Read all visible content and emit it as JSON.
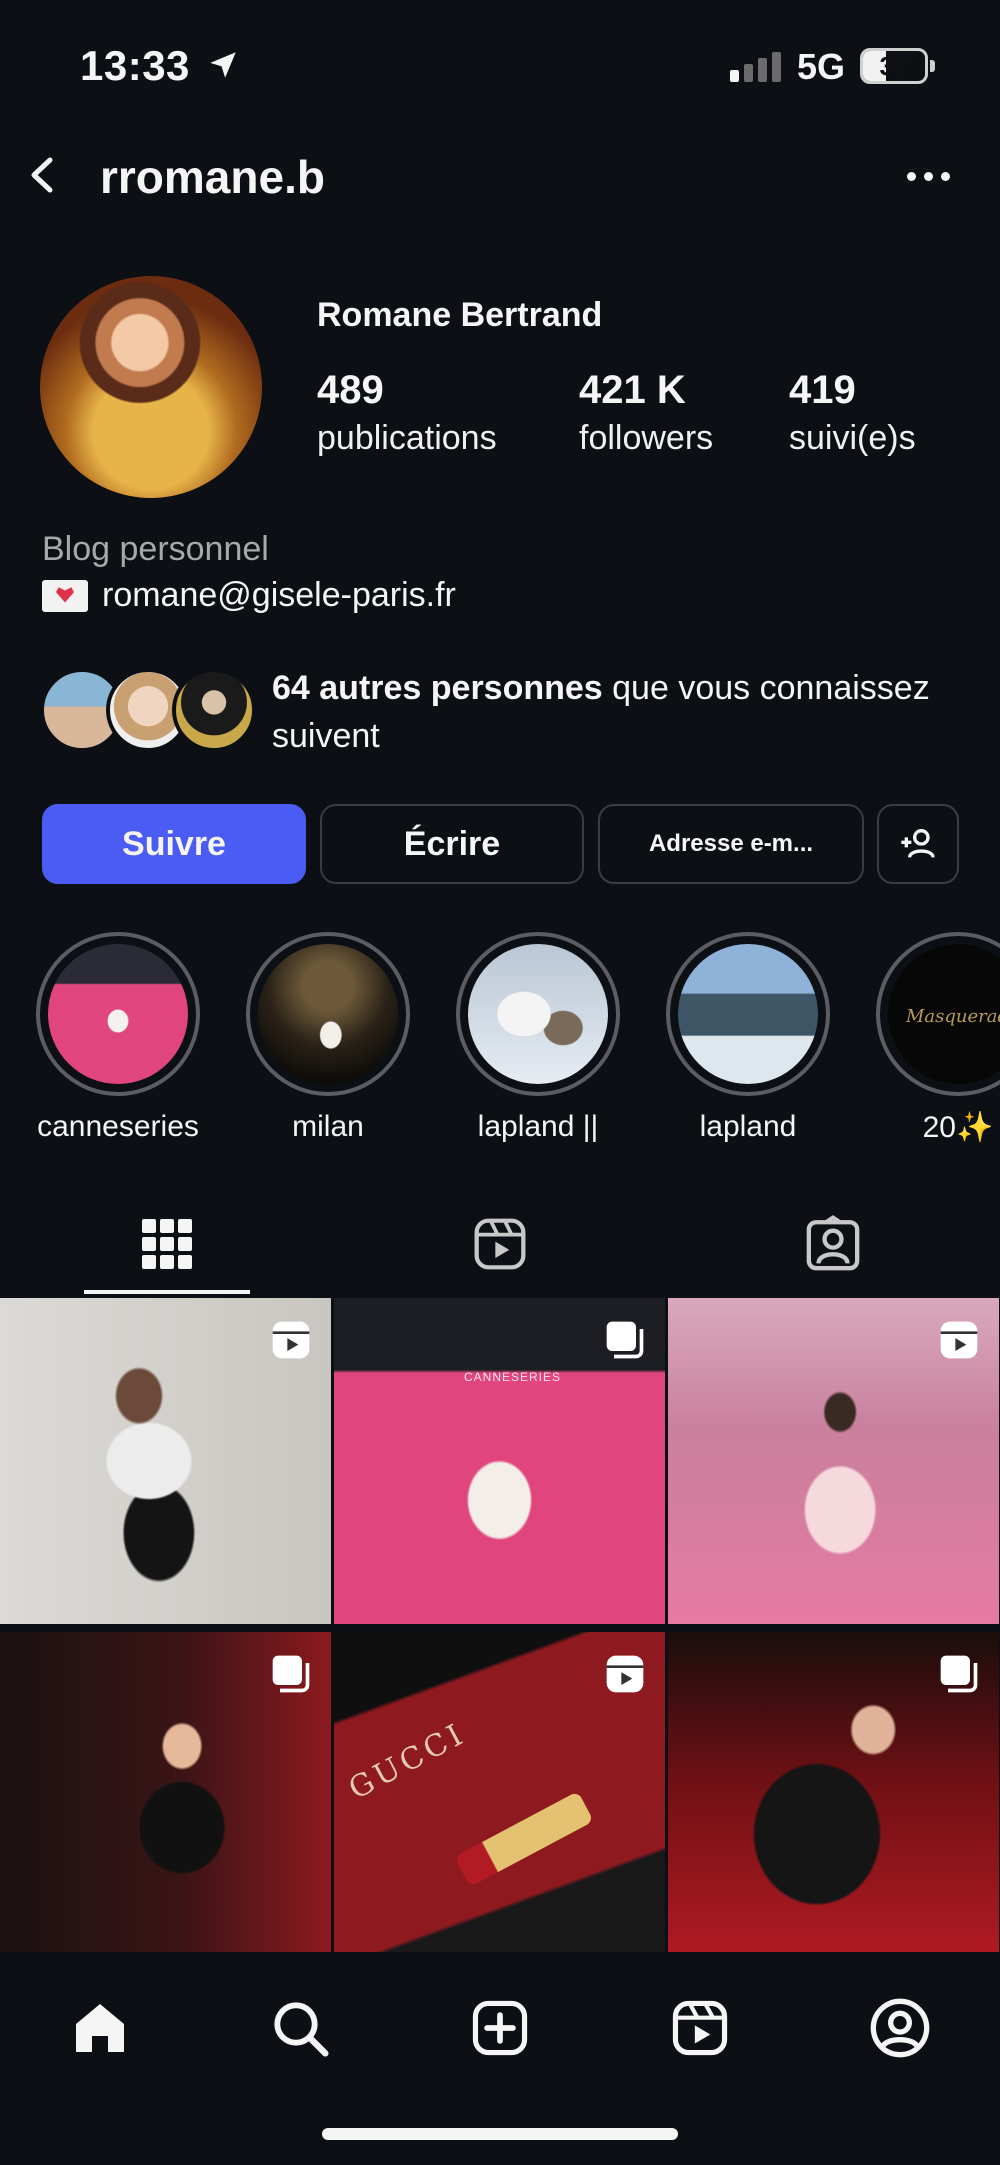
{
  "status_bar": {
    "time": "13:33",
    "network": "5G",
    "battery": "37",
    "battery_level": 0.37
  },
  "header": {
    "username": "rromane.b"
  },
  "profile": {
    "display_name": "Romane Bertrand",
    "stats": [
      {
        "value": "489",
        "label": "publications"
      },
      {
        "value": "421 K",
        "label": "followers"
      },
      {
        "value": "419",
        "label": "suivi(e)s"
      }
    ],
    "bio_category": "Blog personnel",
    "bio_email": "romane@gisele-paris.fr"
  },
  "mutual": {
    "bold": "64 autres personnes",
    "rest": " que vous connaissez suivent"
  },
  "buttons": {
    "follow": "Suivre",
    "message": "Écrire",
    "email": "Adresse e-m..."
  },
  "highlights": [
    {
      "label": "canneseries"
    },
    {
      "label": "milan"
    },
    {
      "label": "lapland ||"
    },
    {
      "label": "lapland"
    },
    {
      "label": "20✨"
    }
  ],
  "tabs": [
    "grid-tab",
    "reels-tab",
    "tagged-tab"
  ],
  "posts": [
    {
      "type": "reel"
    },
    {
      "type": "carousel"
    },
    {
      "type": "reel"
    },
    {
      "type": "carousel"
    },
    {
      "type": "reel"
    },
    {
      "type": "carousel"
    }
  ],
  "highlight_overlay": {
    "masquerade_text": "Masquerade B"
  },
  "post_overlay": {
    "brand_text": "GUCCI",
    "banner_text": "CANNESERIES"
  },
  "colors": {
    "accent": "#4a5cf2",
    "background": "#0c0f14",
    "carpet_pink": "#e0457e",
    "carpet_red": "#b21a24"
  }
}
